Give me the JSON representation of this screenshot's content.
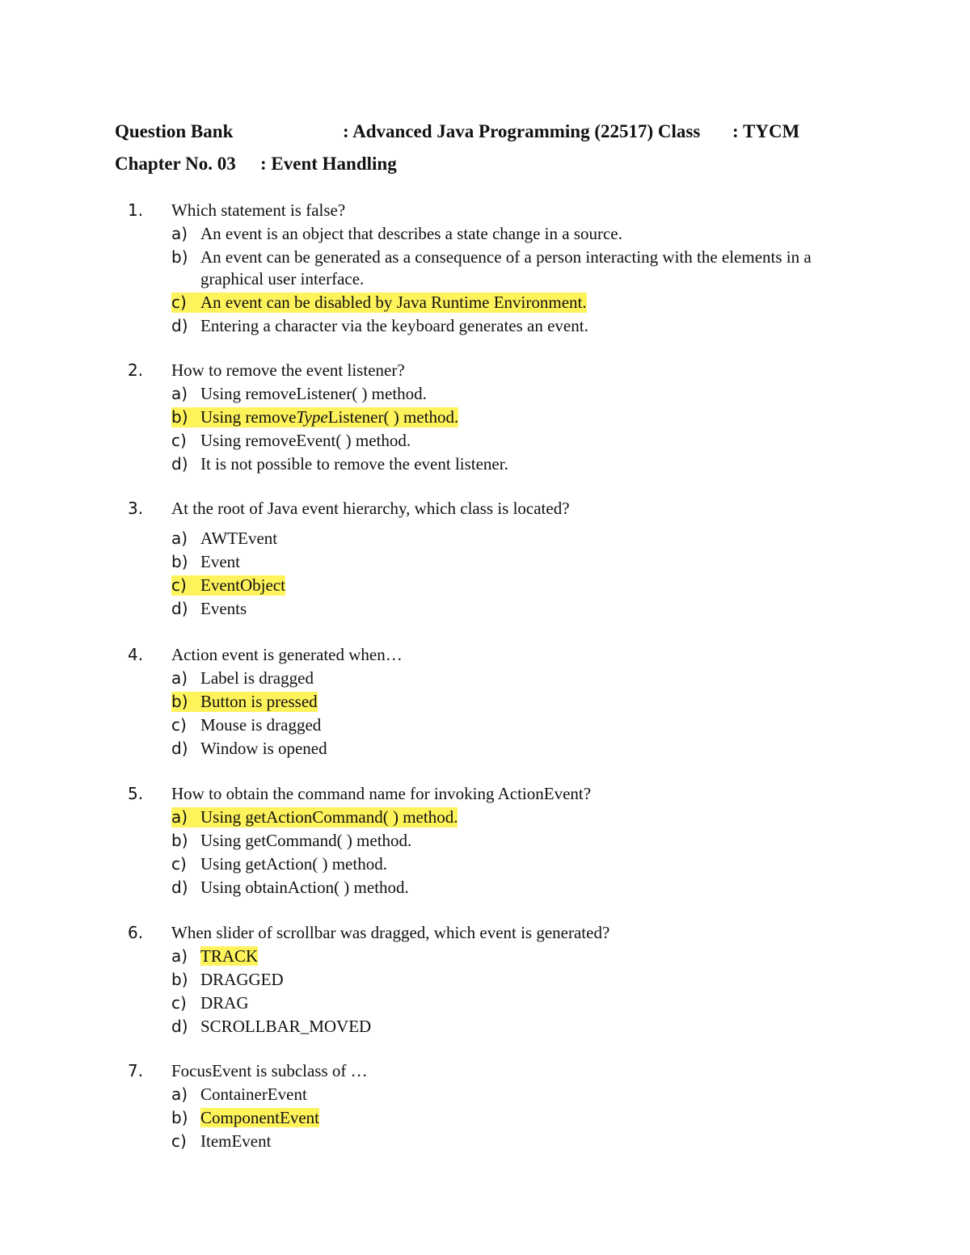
{
  "header": {
    "label1": "Question Bank",
    "subject": ": Advanced Java Programming (22517) Class",
    "class_value": ": TYCM",
    "label2": "Chapter No. 03",
    "chapter": ": Event Handling"
  },
  "highlight_color": "#fff35c",
  "questions": [
    {
      "num": "1.",
      "text": "Which statement is false?",
      "options": [
        {
          "label": "a)",
          "text": "An event is an object that describes a state change in a source."
        },
        {
          "label": "b)",
          "text": "An event can be generated as a consequence of a person interacting with the elements in a",
          "text_cont": "graphical user interface."
        },
        {
          "label": "c)",
          "text": "An event can be disabled by Java Runtime Environment.",
          "correct": true
        },
        {
          "label": "d)",
          "text": "Entering a character via the keyboard generates an event."
        }
      ]
    },
    {
      "num": "2.",
      "text": "How to remove the event listener?",
      "options": [
        {
          "label": "a)",
          "text": "Using removeListener( ) method."
        },
        {
          "label": "b)",
          "text_pre": "Using remove",
          "text_italic": "Type",
          "text_post": "Listener( ) method.",
          "correct": true
        },
        {
          "label": "c)",
          "text": "Using removeEvent( ) method."
        },
        {
          "label": "d)",
          "text": "It is not possible to remove the event listener."
        }
      ]
    },
    {
      "num": "3.",
      "text": "At the root of Java event hierarchy, which class is located?",
      "options": [
        {
          "label": "a)",
          "text": "AWTEvent"
        },
        {
          "label": "b)",
          "text": "Event"
        },
        {
          "label": "c)",
          "text": "EventObject",
          "correct": true
        },
        {
          "label": "d)",
          "text": "Events"
        }
      ]
    },
    {
      "num": "4.",
      "text": "Action event is generated when…",
      "options": [
        {
          "label": "a)",
          "text": "Label is dragged"
        },
        {
          "label": "b)",
          "text": "Button is pressed",
          "correct": true
        },
        {
          "label": "c)",
          "text": "Mouse is dragged"
        },
        {
          "label": "d)",
          "text": "Window is opened"
        }
      ]
    },
    {
      "num": "5.",
      "text": "How to obtain the command name for invoking ActionEvent?",
      "options": [
        {
          "label": "a)",
          "text": "Using getActionCommand( ) method.",
          "correct": true
        },
        {
          "label": "b)",
          "text": "Using getCommand( ) method."
        },
        {
          "label": "c)",
          "text": "Using getAction( ) method."
        },
        {
          "label": "d)",
          "text": "Using obtainAction( ) method."
        }
      ]
    },
    {
      "num": "6.",
      "text": "When slider of scrollbar was dragged, which event is generated?",
      "options": [
        {
          "label": "a)",
          "text": "TRACK",
          "correct": true
        },
        {
          "label": "b)",
          "text": "DRAGGED"
        },
        {
          "label": "c)",
          "text": "DRAG"
        },
        {
          "label": "d)",
          "text": "SCROLLBAR_MOVED"
        }
      ]
    },
    {
      "num": "7.",
      "text": "FocusEvent is subclass of …",
      "options": [
        {
          "label": "a)",
          "text": "ContainerEvent"
        },
        {
          "label": "b)",
          "text": "ComponentEvent",
          "correct": true
        },
        {
          "label": "c)",
          "text": "ItemEvent"
        }
      ]
    }
  ]
}
